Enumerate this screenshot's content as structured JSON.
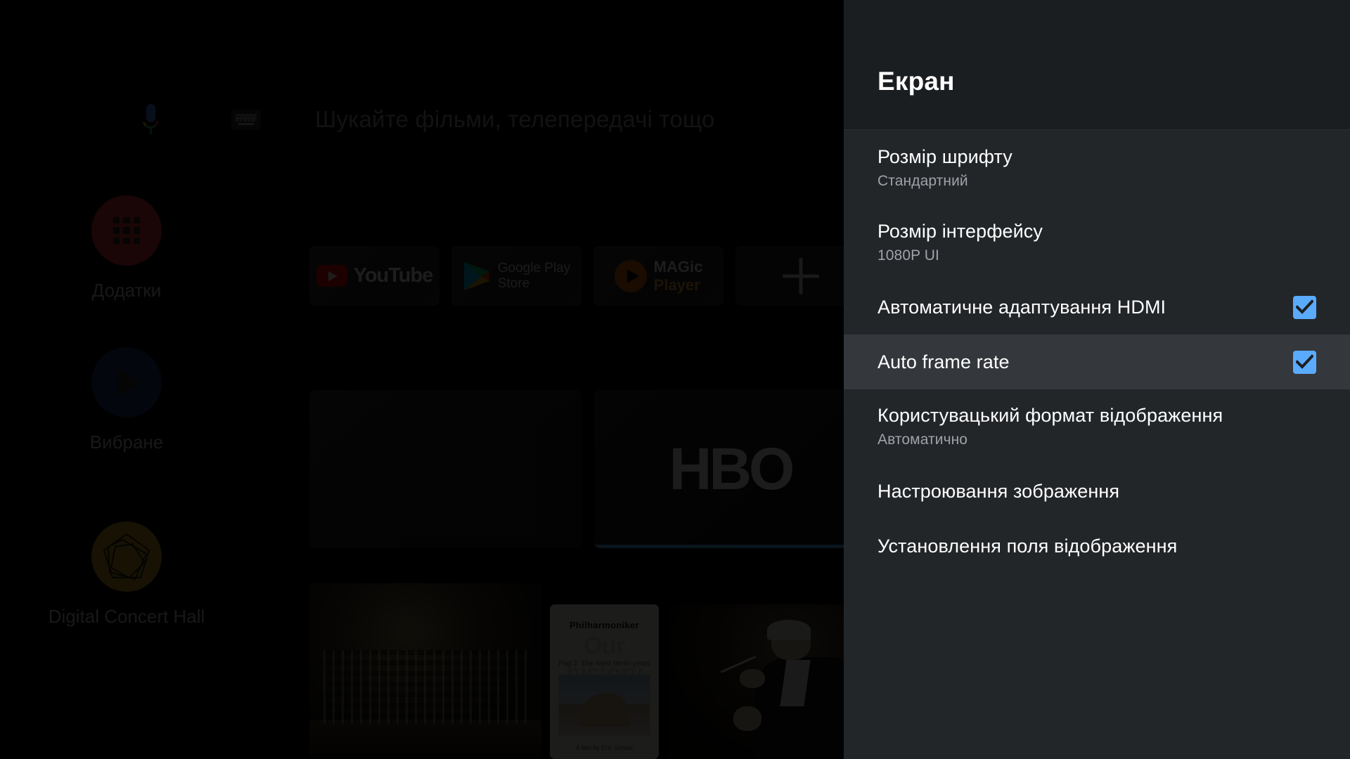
{
  "background": {
    "search": {
      "placeholder": "Шукайте фільми, телепередачі тощо",
      "mic_icon": "microphone-icon",
      "keyboard_icon": "keyboard-icon"
    },
    "rail": [
      {
        "label": "Додатки",
        "icon": "apps-grid-icon",
        "color": "#E53935"
      },
      {
        "label": "Вибране",
        "icon": "play-triangle-icon",
        "color": "#1A3A6B"
      },
      {
        "label": "Digital Concert Hall",
        "icon": "pentagon-logo-icon",
        "color": "#C9A227"
      }
    ],
    "apps": [
      {
        "label": "YouTube",
        "icon": "youtube-icon"
      },
      {
        "label": "Google Play Store",
        "line1": "Google Play",
        "line2": "Store",
        "icon": "google-play-icon"
      },
      {
        "label": "MAGic Player",
        "line1": "MAGic",
        "line2": "Player",
        "icon": "magic-player-icon"
      },
      {
        "label": "Add app",
        "icon": "plus-icon"
      }
    ],
    "media_cards": [
      {
        "label": ""
      },
      {
        "label": "HBO"
      }
    ],
    "photos": [
      {
        "name": "concert-hall-orchestra"
      },
      {
        "name": "our-history-poster",
        "title": "Philharmoniker",
        "headline": "Our history",
        "subtitle": "Part 2: The West Berlin years",
        "caption": "A film by Eric Schulz"
      },
      {
        "name": "conductor-portrait"
      }
    ]
  },
  "panel": {
    "title": "Екран",
    "accent_color": "#5BABFC",
    "focused_row_color": "#34373B",
    "items": [
      {
        "id": "font-size",
        "title": "Розмір шрифту",
        "subtitle": "Стандартний",
        "type": "value",
        "focused": false
      },
      {
        "id": "ui-size",
        "title": "Розмір інтерфейсу",
        "subtitle": "1080P UI",
        "type": "value",
        "focused": false
      },
      {
        "id": "hdmi-auto-adapt",
        "title": "Автоматичне адаптування HDMI",
        "subtitle": "",
        "type": "checkbox",
        "checked": true,
        "focused": false
      },
      {
        "id": "auto-frame-rate",
        "title": "Auto frame rate",
        "subtitle": "",
        "type": "checkbox",
        "checked": true,
        "focused": true
      },
      {
        "id": "custom-format",
        "title": "Користувацький формат відображення",
        "subtitle": "Автоматично",
        "type": "value",
        "focused": false
      },
      {
        "id": "picture-settings",
        "title": "Настроювання зображення",
        "subtitle": "",
        "type": "plain",
        "focused": false
      },
      {
        "id": "screen-position",
        "title": "Установлення поля відображення",
        "subtitle": "",
        "type": "plain",
        "focused": false
      }
    ]
  }
}
